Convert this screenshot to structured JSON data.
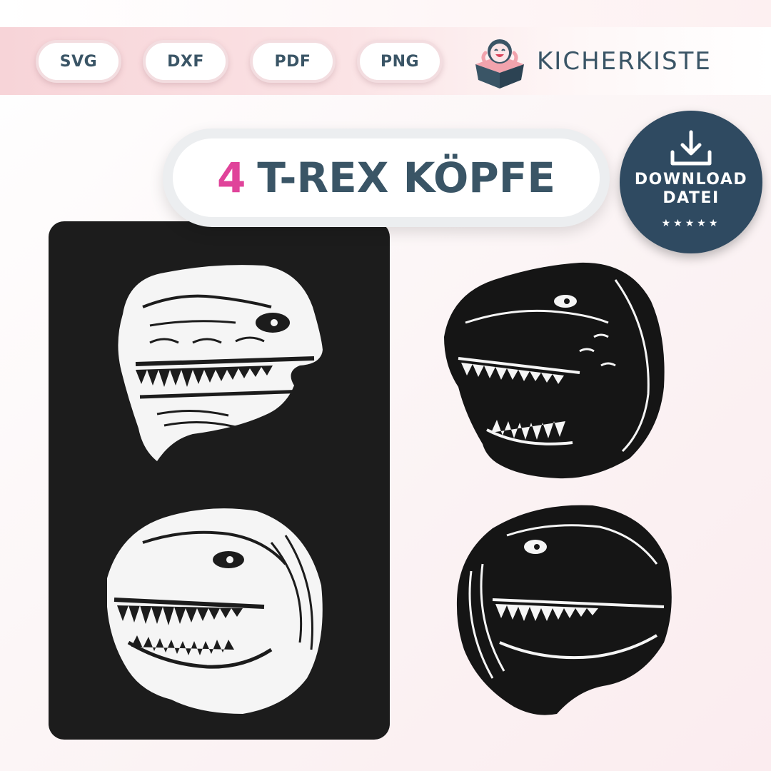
{
  "formats": [
    "SVG",
    "DXF",
    "PDF",
    "PNG"
  ],
  "brand": {
    "name": "KICHERKISTE",
    "logo_icon": "laughing-child-box-logo"
  },
  "title": {
    "number": "4",
    "text": "T-REX KÖPFE"
  },
  "download_badge": {
    "icon": "download-icon",
    "line1": "DOWNLOAD",
    "line2": "DATEI",
    "stars": "★★★★★"
  },
  "colors": {
    "brand_text": "#3a5566",
    "accent_pink": "#e0439a",
    "badge_bg": "#2f4a61",
    "panel_bg": "#1c1c1c"
  },
  "artwork": [
    "trex-head-white-top",
    "trex-head-white-bottom",
    "trex-head-black-top",
    "trex-head-black-bottom"
  ]
}
